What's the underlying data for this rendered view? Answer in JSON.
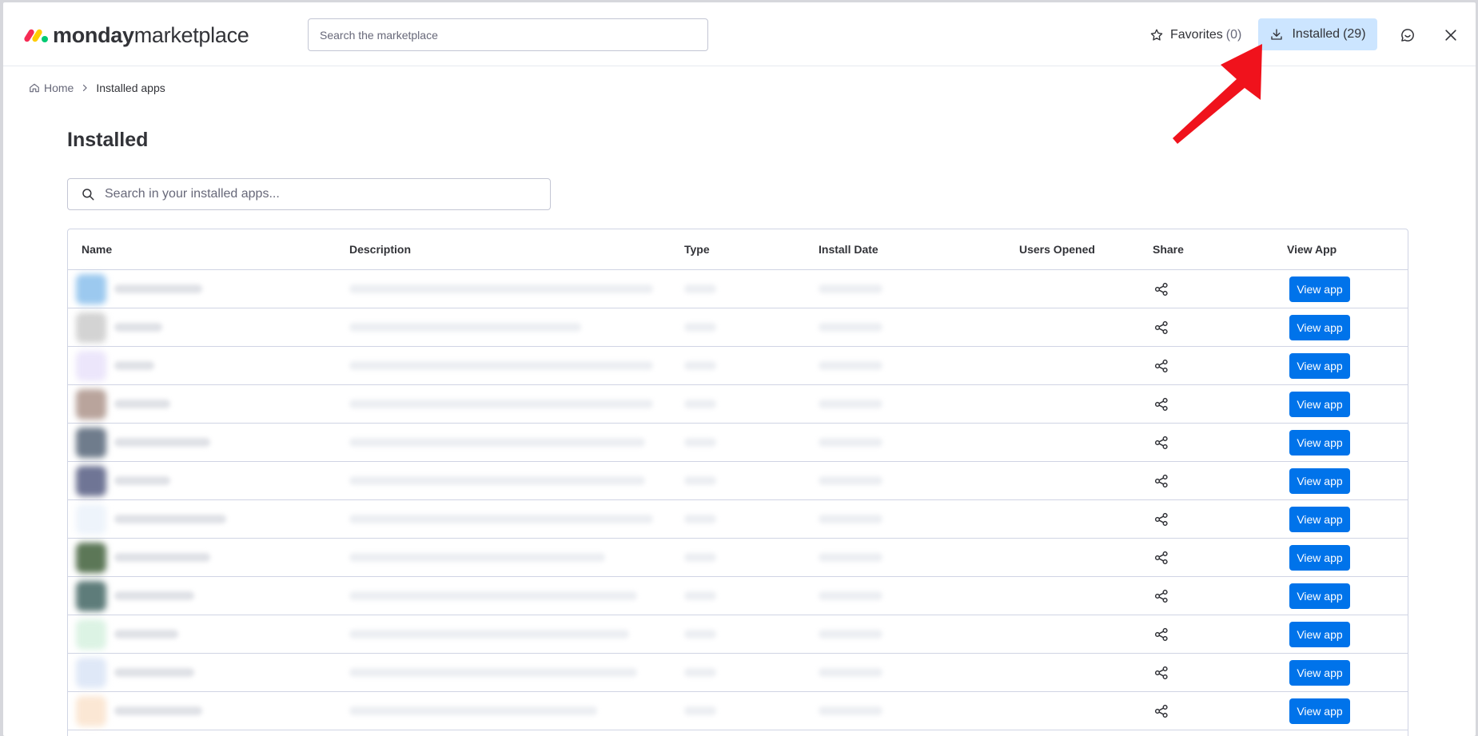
{
  "header": {
    "brand_bold": "monday",
    "brand_rest": "marketplace",
    "search_placeholder": "Search the marketplace",
    "favorites_label": "Favorites",
    "favorites_count": "(0)",
    "installed_label": "Installed",
    "installed_count": "(29)"
  },
  "breadcrumb": {
    "home": "Home",
    "current": "Installed apps"
  },
  "page": {
    "title": "Installed",
    "search_placeholder": "Search in your installed apps..."
  },
  "table": {
    "columns": [
      "Name",
      "Description",
      "Type",
      "Install Date",
      "Users Opened",
      "Share",
      "View App"
    ],
    "view_button_label": "View app",
    "rows": [
      {
        "icon_color": "#9cc9ef"
      },
      {
        "icon_color": "#d3d3d3"
      },
      {
        "icon_color": "#ece6fb"
      },
      {
        "icon_color": "#b9a49c"
      },
      {
        "icon_color": "#6f7c8c"
      },
      {
        "icon_color": "#6f7595"
      },
      {
        "icon_color": "#eef4fb"
      },
      {
        "icon_color": "#5c7757"
      },
      {
        "icon_color": "#5e7c7a"
      },
      {
        "icon_color": "#dcf3e4"
      },
      {
        "icon_color": "#dfe8f7"
      },
      {
        "icon_color": "#fbe7d4"
      }
    ]
  },
  "colors": {
    "primary": "#0073ea",
    "installed_bg": "#cce5ff",
    "annotation_arrow": "#f0121c"
  }
}
